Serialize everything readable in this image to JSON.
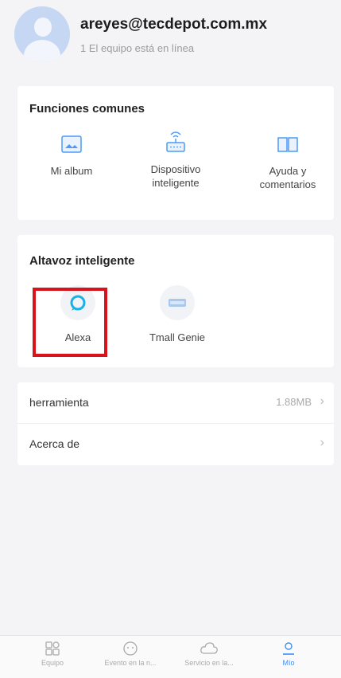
{
  "profile": {
    "email": "areyes@tecdepot.com.mx",
    "status": "1 El equipo está en línea"
  },
  "common_functions": {
    "title": "Funciones comunes",
    "items": [
      {
        "icon": "photo-album-icon",
        "label_lines": [
          "Mi album"
        ]
      },
      {
        "icon": "smart-device-icon",
        "label_lines": [
          "Dispositivo",
          "inteligente"
        ]
      },
      {
        "icon": "help-book-icon",
        "label_lines": [
          "Ayuda y",
          "comentarios"
        ]
      }
    ]
  },
  "smart_speaker": {
    "title": "Altavoz inteligente",
    "items": [
      {
        "icon": "alexa-icon",
        "label": "Alexa"
      },
      {
        "icon": "tmall-genie-icon",
        "label": "Tmall Genie"
      }
    ]
  },
  "list": [
    {
      "label": "herramienta",
      "value": "1.88MB"
    },
    {
      "label": "Acerca de",
      "value": ""
    }
  ],
  "tabbar": {
    "tabs": [
      {
        "icon": "device-grid-icon",
        "label": "Equipo",
        "active": false
      },
      {
        "icon": "event-face-icon",
        "label": "Evento en la n...",
        "active": false
      },
      {
        "icon": "cloud-icon",
        "label": "Servicio en la...",
        "active": false
      },
      {
        "icon": "profile-icon",
        "label": "Mío",
        "active": true
      }
    ]
  },
  "colors": {
    "accent": "#3d8ef7",
    "highlight_box": "#d8131b",
    "background": "#f4f4f6"
  }
}
